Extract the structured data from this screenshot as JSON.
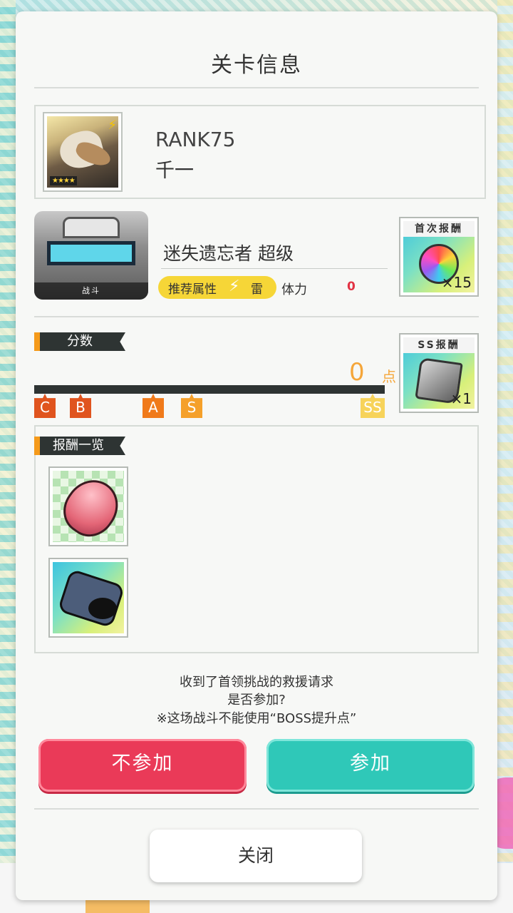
{
  "dialog": {
    "title": "关卡信息"
  },
  "player": {
    "rank": "RANK75",
    "name": "千一",
    "stars": "★★★★",
    "element_icon": "lightning-icon"
  },
  "stage": {
    "thumb_tag": "战斗",
    "name": "迷失遗忘者 超级",
    "recommended_label": "推荐属性",
    "recommended_element": "雷",
    "stamina_label": "体力",
    "stamina_value": "0"
  },
  "first_reward": {
    "title": "首次报酬",
    "count": "×15",
    "icon": "rainbow-orb-icon"
  },
  "ss_reward": {
    "title": "SS报酬",
    "count": "×1",
    "icon": "stone-icon"
  },
  "score": {
    "label": "分数",
    "value": "0",
    "unit": "点",
    "grades": [
      "C",
      "B",
      "A",
      "S",
      "SS"
    ],
    "grade_colors": [
      "#e0541e",
      "#e0541e",
      "#f07a1a",
      "#f5a02a",
      "#f7d35a"
    ],
    "progress": 0
  },
  "reward_list": {
    "label": "报酬一览",
    "items": [
      {
        "icon": "pink-egg-icon"
      },
      {
        "icon": "gadget-icon"
      }
    ]
  },
  "prompt": {
    "line1": "收到了首领挑战的救援请求",
    "line2": "是否参加?",
    "line3": "※这场战斗不能使用“BOSS提升点”"
  },
  "buttons": {
    "decline": "不参加",
    "join": "参加",
    "close": "关闭"
  },
  "colors": {
    "decline": "#ea3a58",
    "join": "#2fc8b8",
    "accent": "#f59a1a",
    "score": "#f5a63a"
  }
}
